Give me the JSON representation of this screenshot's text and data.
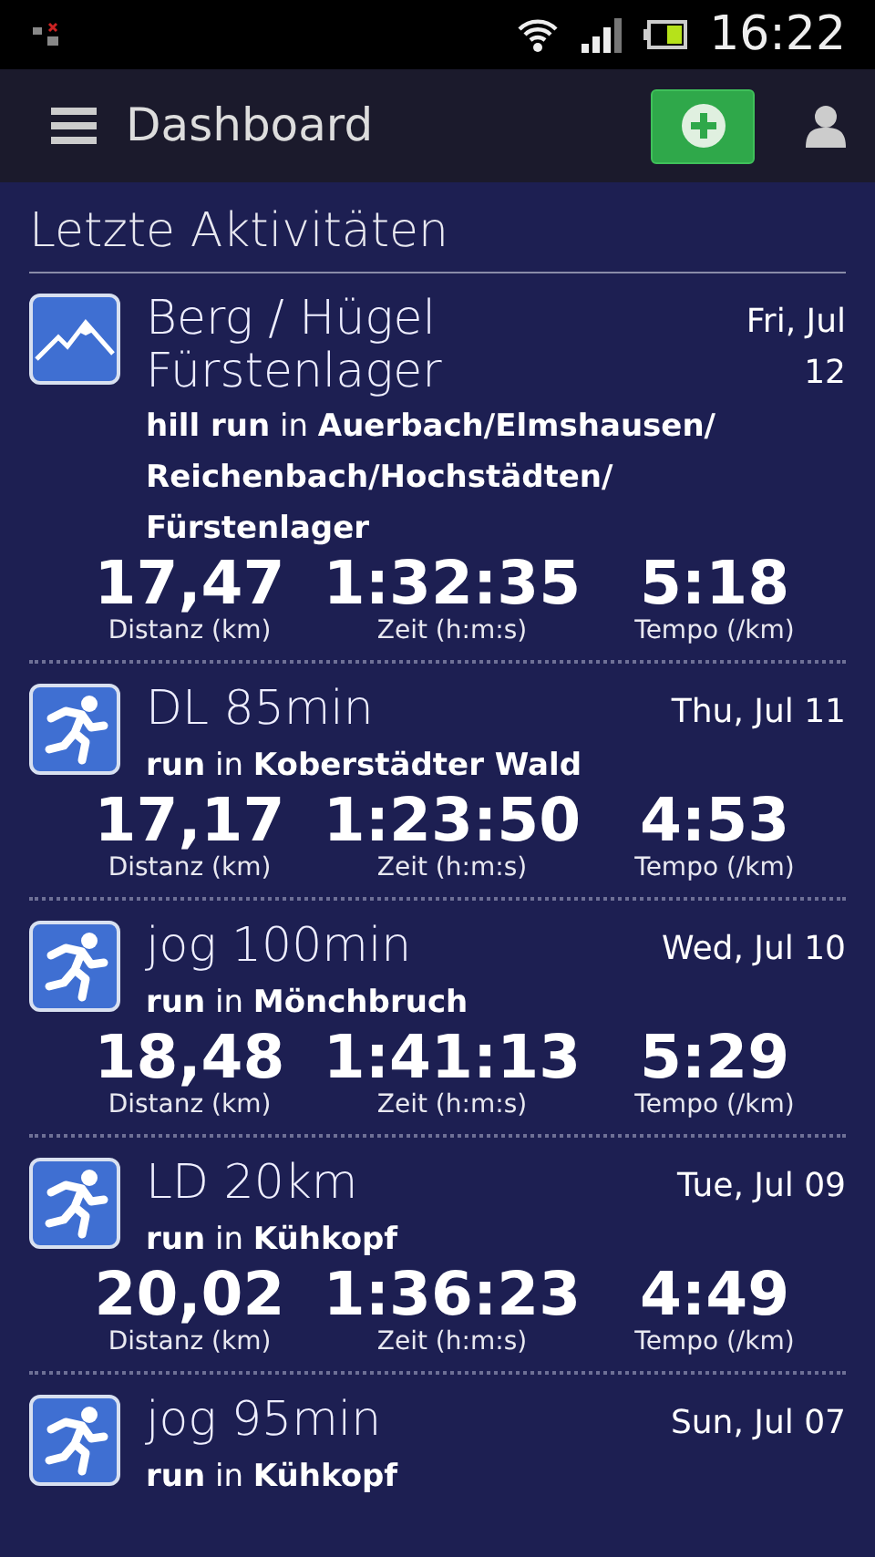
{
  "status_bar": {
    "time": "16:22"
  },
  "app_bar": {
    "title": "Dashboard"
  },
  "section_title": "Letzte Aktivitäten",
  "activities": [
    {
      "kind": "hill",
      "title": "Berg / Hügel Fürstenlager",
      "date": "Fri, Jul 12",
      "sport": "**hill run** in **Auerbach/Elmshausen/ Reichenbach/Hochstädten/ Fürstenlager**",
      "stats": [
        {
          "value": "17,47",
          "label": "Distanz (km)"
        },
        {
          "value": "1:32:35",
          "label": "Zeit (h:m:s)"
        },
        {
          "value": "5:18",
          "label": "Tempo (/km)"
        }
      ]
    },
    {
      "kind": "run",
      "title": "DL 85min",
      "date": "Thu, Jul 11",
      "sport": "**run** in **Koberstädter Wald**",
      "stats": [
        {
          "value": "17,17",
          "label": "Distanz (km)"
        },
        {
          "value": "1:23:50",
          "label": "Zeit (h:m:s)"
        },
        {
          "value": "4:53",
          "label": "Tempo (/km)"
        }
      ]
    },
    {
      "kind": "run",
      "title": "jog 100min",
      "date": "Wed, Jul 10",
      "sport": "**run** in **Mönchbruch**",
      "stats": [
        {
          "value": "18,48",
          "label": "Distanz (km)"
        },
        {
          "value": "1:41:13",
          "label": "Zeit (h:m:s)"
        },
        {
          "value": "5:29",
          "label": "Tempo (/km)"
        }
      ]
    },
    {
      "kind": "run",
      "title": "LD 20km",
      "date": "Tue, Jul 09",
      "sport": "**run** in **Kühkopf**",
      "stats": [
        {
          "value": "20,02",
          "label": "Distanz (km)"
        },
        {
          "value": "1:36:23",
          "label": "Zeit (h:m:s)"
        },
        {
          "value": "4:49",
          "label": "Tempo (/km)"
        }
      ]
    },
    {
      "kind": "run",
      "title": "jog 95min",
      "date": "Sun, Jul 07",
      "sport": "**run** in **Kühkopf**"
    }
  ]
}
